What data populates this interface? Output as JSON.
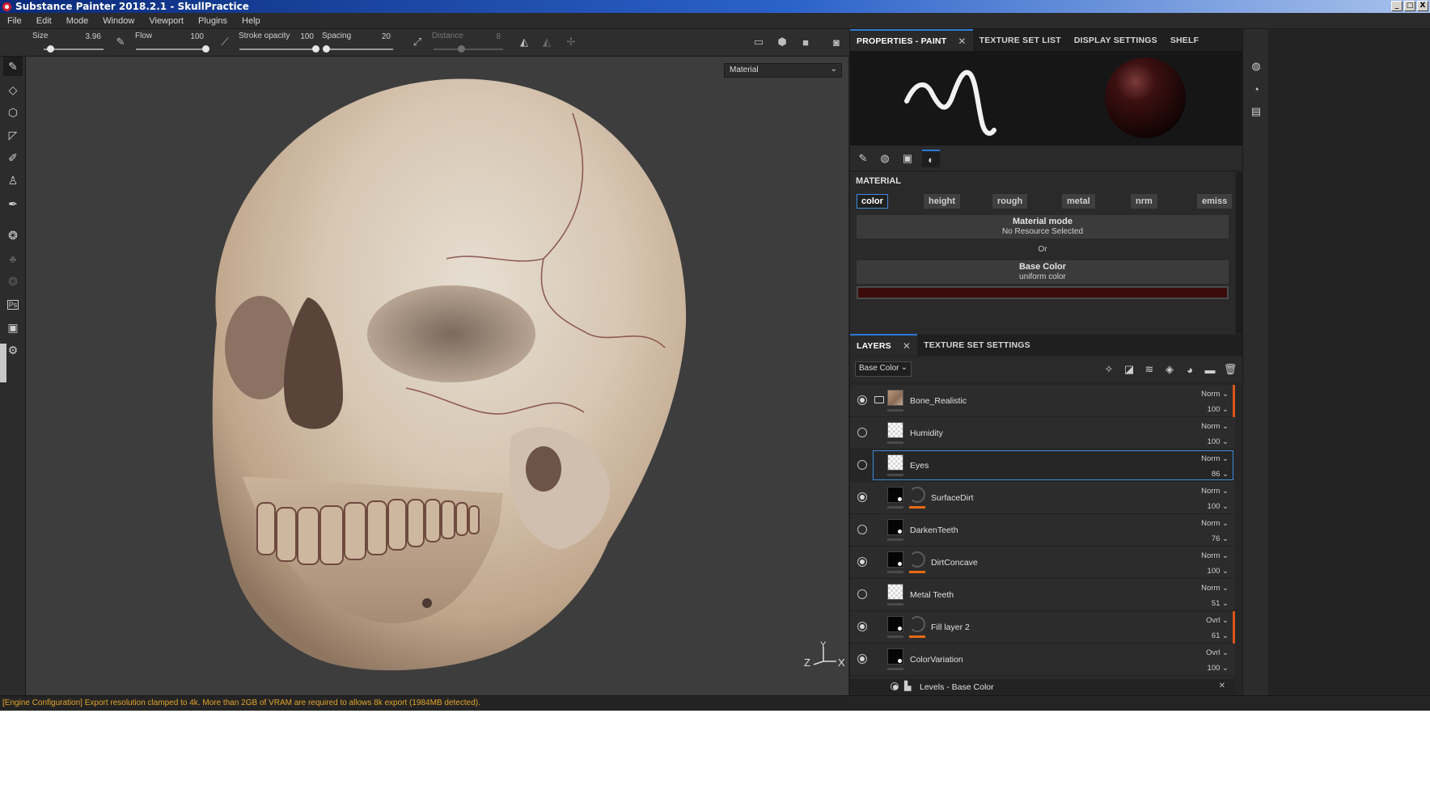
{
  "window": {
    "title": "Substance Painter 2018.2.1 - SkullPractice",
    "controls": [
      "_",
      "□",
      "X"
    ]
  },
  "menu": [
    "File",
    "Edit",
    "Mode",
    "Window",
    "Viewport",
    "Plugins",
    "Help"
  ],
  "toolbar": {
    "size_label": "Size",
    "size_value": "3.96",
    "size_level": 0.11,
    "flow_label": "Flow",
    "flow_value": "100",
    "flow_level": 1.0,
    "stroke_opacity_label": "Stroke opacity",
    "stroke_opacity_value": "100",
    "stroke_opacity_level": 1.0,
    "spacing_label": "Spacing",
    "spacing_value": "20",
    "spacing_level": 0.04,
    "distance_label": "Distance",
    "distance_value": "8",
    "distance_level": 0.4
  },
  "viewport": {
    "mode_select": "Material",
    "axis": {
      "y": "Y",
      "z": "Z",
      "x": "X"
    }
  },
  "status": "[Engine Configuration] Export resolution clamped to 4k. More than 2GB of VRAM are required to allows 8k export (1984MB detected).",
  "properties_tabs": [
    {
      "label": "PROPERTIES - PAINT",
      "active": true,
      "close": "✕"
    },
    {
      "label": "TEXTURE SET LIST",
      "active": false
    },
    {
      "label": "DISPLAY SETTINGS",
      "active": false
    },
    {
      "label": "SHELF",
      "active": false
    }
  ],
  "material": {
    "section_title": "MATERIAL",
    "channels": [
      "color",
      "height",
      "rough",
      "metal",
      "nrm",
      "emiss"
    ],
    "active_channel": "color",
    "material_mode_title": "Material mode",
    "material_mode_value": "No Resource Selected",
    "or_label": "Or",
    "base_color_title": "Base Color",
    "base_color_value": "uniform color",
    "base_color_swatch": "#3b0b0b"
  },
  "layers_tabs": [
    {
      "label": "LAYERS",
      "active": true,
      "close": "✕"
    },
    {
      "label": "TEXTURE SET SETTINGS",
      "active": false
    }
  ],
  "layers_channel": "Base Color",
  "layers": [
    {
      "name": "Bone_Realistic",
      "blend": "Norm",
      "opacity": "100",
      "visible": true,
      "thumb": "bone",
      "folder": true,
      "mask": false,
      "edge": true
    },
    {
      "name": "Humidity",
      "blend": "Norm",
      "opacity": "100",
      "visible": false,
      "thumb": "check",
      "folder": false,
      "mask": false,
      "edge": false
    },
    {
      "name": "Eyes",
      "blend": "Norm",
      "opacity": "86",
      "visible": false,
      "thumb": "check",
      "folder": false,
      "mask": false,
      "edge": false,
      "selected": true
    },
    {
      "name": "SurfaceDirt",
      "blend": "Norm",
      "opacity": "100",
      "visible": true,
      "thumb": "black",
      "folder": false,
      "mask": true,
      "edge": false
    },
    {
      "name": "DarkenTeeth",
      "blend": "Norm",
      "opacity": "76",
      "visible": false,
      "thumb": "black",
      "folder": false,
      "mask": false,
      "edge": false
    },
    {
      "name": "DirtConcave",
      "blend": "Norm",
      "opacity": "100",
      "visible": true,
      "thumb": "black",
      "folder": false,
      "mask": true,
      "edge": false
    },
    {
      "name": "Metal Teeth",
      "blend": "Norm",
      "opacity": "51",
      "visible": false,
      "thumb": "check",
      "folder": false,
      "mask": false,
      "edge": false
    },
    {
      "name": "Fill layer 2",
      "blend": "Ovrl",
      "opacity": "61",
      "visible": true,
      "thumb": "black",
      "folder": false,
      "mask": true,
      "edge": true
    },
    {
      "name": "ColorVariation",
      "blend": "Ovrl",
      "opacity": "100",
      "visible": true,
      "thumb": "black",
      "folder": false,
      "mask": false,
      "edge": false
    }
  ],
  "sub_layer": {
    "name": "Levels - Base Color",
    "close": "✕"
  }
}
